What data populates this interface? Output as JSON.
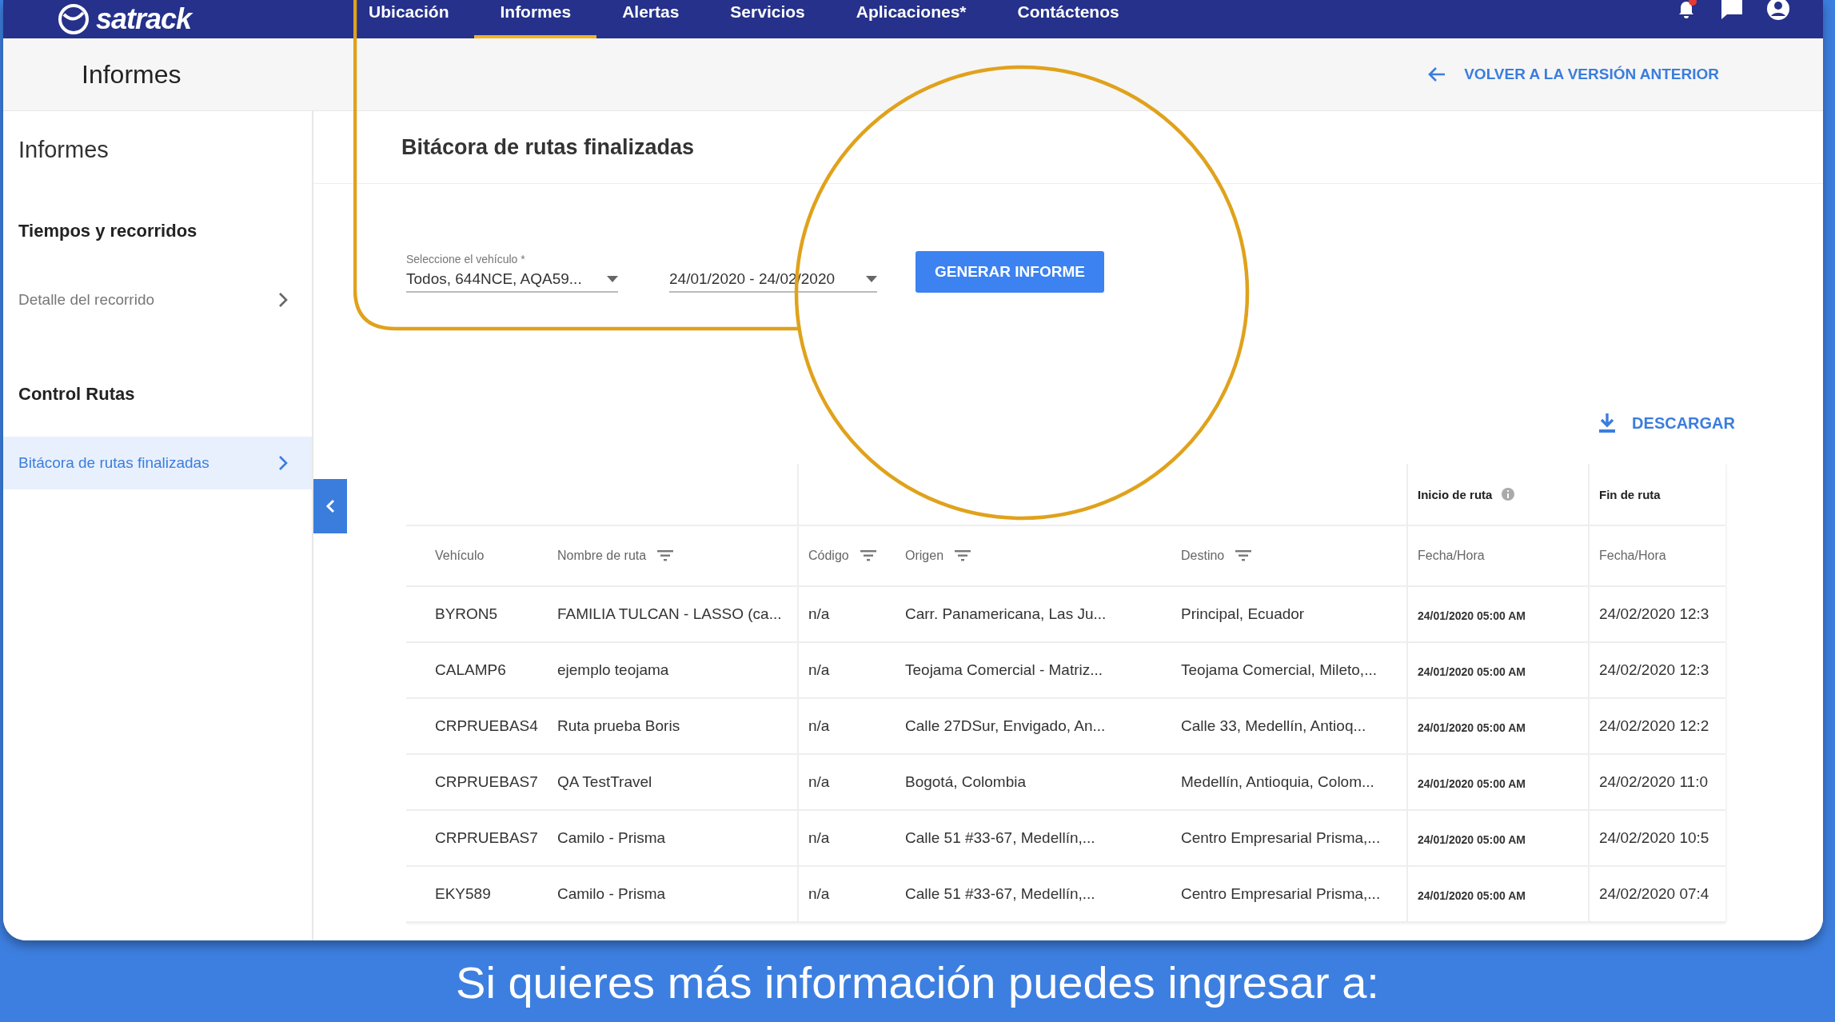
{
  "nav": {
    "logo": "satrack",
    "items": [
      {
        "label": "Ubicación",
        "selected": false
      },
      {
        "label": "Informes",
        "selected": true
      },
      {
        "label": "Alertas",
        "selected": false
      },
      {
        "label": "Servicios",
        "selected": false
      },
      {
        "label": "Aplicaciones*",
        "selected": false
      },
      {
        "label": "Contáctenos",
        "selected": false
      }
    ]
  },
  "page_header": {
    "title": "Informes",
    "back_link": "VOLVER A LA VERSIÓN ANTERIOR"
  },
  "sidebar": {
    "title": "Informes",
    "sections": [
      {
        "heading": "Tiempos y recorridos",
        "items": [
          {
            "label": "Detalle del recorrido",
            "selected": false
          }
        ]
      },
      {
        "heading": "Control Rutas",
        "items": [
          {
            "label": "Bitácora de rutas finalizadas",
            "selected": true
          }
        ]
      }
    ]
  },
  "report": {
    "title": "Bitácora de rutas finalizadas",
    "vehicle_select": {
      "label": "Seleccione el vehículo *",
      "value": "Todos, 644NCE, AQA59..."
    },
    "date_range": {
      "value": "24/01/2020 - 24/02/2020"
    },
    "generate_button": "GENERAR INFORME",
    "download_button": "DESCARGAR"
  },
  "table": {
    "group_headers": [
      {
        "label": "Inicio de ruta",
        "info": true
      },
      {
        "label": "Fin de ruta",
        "info": false
      }
    ],
    "columns": [
      {
        "label": "Vehículo",
        "filter": false
      },
      {
        "label": "Nombre de ruta",
        "filter": true
      },
      {
        "label": "Código",
        "filter": true
      },
      {
        "label": "Origen",
        "filter": true
      },
      {
        "label": "Destino",
        "filter": true
      },
      {
        "label": "Fecha/Hora",
        "filter": false
      },
      {
        "label": "Fecha/Hora",
        "filter": false
      }
    ],
    "rows": [
      [
        "BYRON5",
        "FAMILIA TULCAN - LASSO (ca...",
        "n/a",
        "Carr. Panamericana, Las Ju...",
        "Principal, Ecuador",
        "24/01/2020 05:00 AM",
        "24/02/2020 12:3"
      ],
      [
        "CALAMP6",
        "ejemplo teojama",
        "n/a",
        "Teojama Comercial - Matriz...",
        "Teojama Comercial, Mileto,...",
        "24/01/2020 05:00 AM",
        "24/02/2020 12:3"
      ],
      [
        "CRPRUEBAS4",
        "Ruta prueba Boris",
        "n/a",
        "Calle 27DSur, Envigado, An...",
        "Calle 33, Medellín, Antioq...",
        "24/01/2020 05:00 AM",
        "24/02/2020 12:2"
      ],
      [
        "CRPRUEBAS7",
        "QA TestTravel",
        "n/a",
        "Bogotá, Colombia",
        "Medellín, Antioquia, Colom...",
        "24/01/2020 05:00 AM",
        "24/02/2020 11:0"
      ],
      [
        "CRPRUEBAS7",
        "Camilo - Prisma",
        "n/a",
        "Calle 51 #33-67, Medellín,...",
        "Centro Empresarial Prisma,...",
        "24/01/2020 05:00 AM",
        "24/02/2020 10:5"
      ],
      [
        "EKY589",
        "Camilo - Prisma",
        "n/a",
        "Calle 51 #33-67, Medellín,...",
        "Centro Empresarial Prisma,...",
        "24/01/2020 05:00 AM",
        "24/02/2020 07:4"
      ]
    ]
  },
  "footer_caption": "Si quieres más información puedes ingresar a:"
}
